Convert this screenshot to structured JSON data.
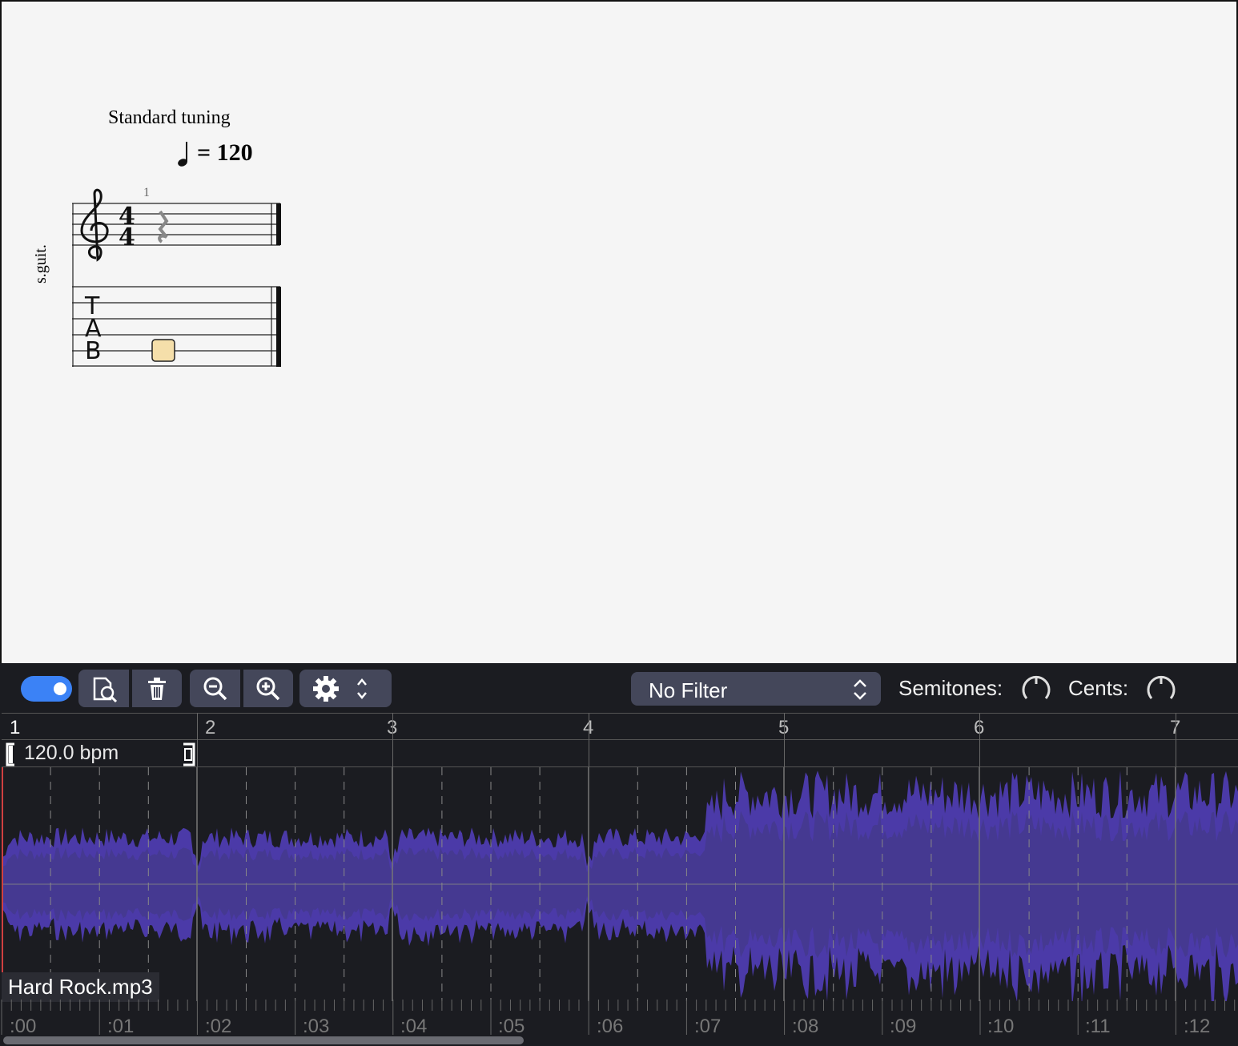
{
  "score": {
    "tuning": "Standard tuning",
    "tempo": "= 120",
    "measure_number": "1",
    "instrument": "s.guit.",
    "tab_letters": [
      "T",
      "A",
      "B"
    ]
  },
  "toolbar": {
    "toggle_on": true,
    "filter_value": "No Filter",
    "semitones_label": "Semitones:",
    "cents_label": "Cents:"
  },
  "timeline": {
    "bar_numbers": [
      "1",
      "2",
      "3",
      "4",
      "5",
      "6",
      "7"
    ],
    "bpm": "120.0 bpm",
    "file_name": "Hard Rock.mp3",
    "time_labels": [
      ":00",
      ":01",
      ":02",
      ":03",
      ":04",
      ":05",
      ":06",
      ":07",
      ":08",
      ":09",
      ":10",
      ":11",
      ":12"
    ]
  },
  "colors": {
    "waveform": "#4a3b9c",
    "waveform_peak": "#5a48c8",
    "toggle": "#3b82f6",
    "panel_bg": "#1b1c21",
    "button_bg": "#44475a"
  }
}
